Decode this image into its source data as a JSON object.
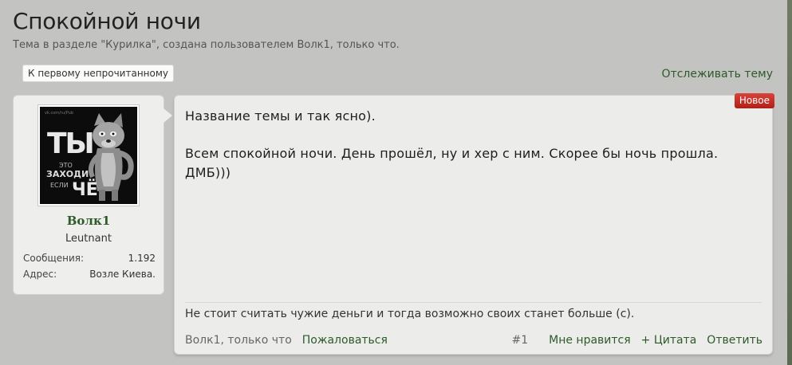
{
  "thread": {
    "title": "Спокойной ночи",
    "subtitle": "Тема в разделе \"Курилка\", создана пользователем Волк1, только что.",
    "first_unread_label": "К первому непрочитанному",
    "watch_label": "Отслеживать тему"
  },
  "user": {
    "name": "Волк1",
    "rank": "Leutnant",
    "avatar_text": {
      "tiny": "vk.com/ru/Pub",
      "big": "ТЫ",
      "small1": "ЭТО",
      "mid": "ЗАХОДИ",
      "small2": "ЕСЛИ",
      "che": "ЧЁ"
    },
    "stats": [
      {
        "key": "Сообщения:",
        "value": "1.192"
      },
      {
        "key": "Адрес:",
        "value": "Возле Киева."
      }
    ]
  },
  "post": {
    "badge": "Новое",
    "paragraphs": [
      "Название темы и так ясно).",
      "Всем спокойной ночи. День прошёл, ну и хер с ним. Скорее бы ночь прошла. ДМБ)))"
    ],
    "signature": "Не стоит считать чужие деньги и тогда возможно своих станет больше (с).",
    "meta": "Волк1, только что",
    "report_label": "Пожаловаться",
    "number": "#1",
    "like_label": "Мне нравится",
    "quote_label": "+ Цитата",
    "reply_label": "Ответить"
  },
  "colors": {
    "background": "#c3c3c1",
    "link_green": "#2e5a2a",
    "badge_red": "#c62a22"
  }
}
